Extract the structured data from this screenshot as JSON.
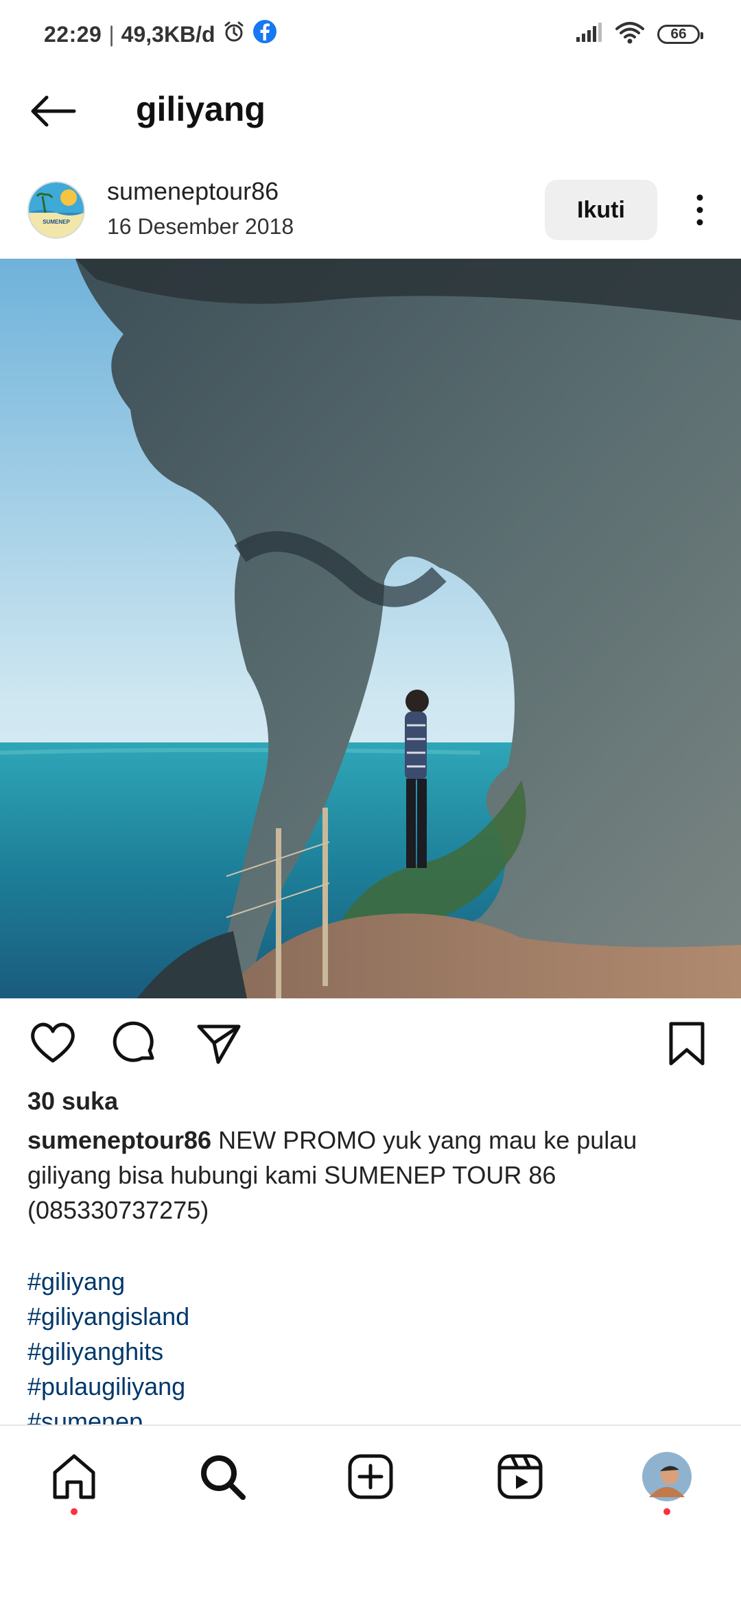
{
  "status_bar": {
    "time": "22:29",
    "separator": "|",
    "speed": "49,3KB/d",
    "battery": "66"
  },
  "header": {
    "title": "giliyang",
    "back_icon": "arrow-left-icon"
  },
  "post": {
    "username": "sumeneptour86",
    "date": "16 Desember 2018",
    "follow_label": "Ikuti",
    "likes": "30 suka",
    "caption_user": "sumeneptour86",
    "caption_text": " NEW PROMO yuk yang mau ke pulau giliyang bisa hubungi kami SUMENEP TOUR 86 (085330737275)",
    "hashtags": [
      "#giliyang",
      "#giliyangisland",
      "#giliyanghits",
      "#pulaugiliyang",
      "#sumenep"
    ],
    "avatar_text": "SUMENEP"
  },
  "actions": {
    "like_icon": "heart-icon",
    "comment_icon": "comment-icon",
    "share_icon": "send-icon",
    "save_icon": "bookmark-icon"
  },
  "bottom_nav": {
    "items": [
      "home-icon",
      "search-icon",
      "add-post-icon",
      "reels-icon",
      "profile-avatar"
    ]
  },
  "colors": {
    "hashtag": "#00376b",
    "follow_bg": "#efefef",
    "notification_dot": "#ff3040",
    "facebook": "#1877f2"
  }
}
